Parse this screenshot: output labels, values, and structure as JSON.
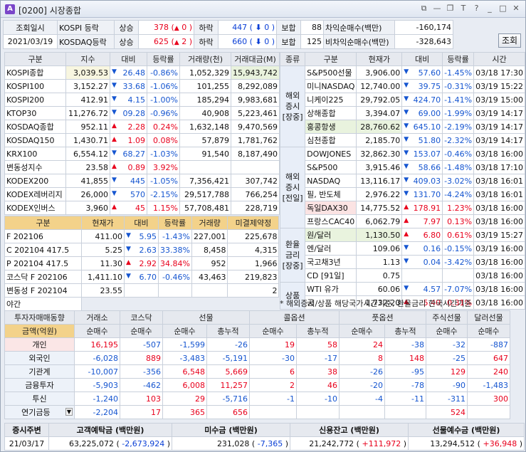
{
  "window": {
    "code": "[0200]",
    "title": "시장종합",
    "icon_letter": "A"
  },
  "header": {
    "date_label": "조회일시",
    "date": "2021/03/19",
    "kospi_label": "KOSPI 등락",
    "kosdaq_label": "KOSDAQ등락",
    "rise": "상승",
    "fall": "하락",
    "flat": "보합",
    "kospi": {
      "rise": "378",
      "rise_up": "0",
      "fall": "447",
      "fall_dn": "0",
      "flat": "88"
    },
    "kosdaq": {
      "rise": "625",
      "rise_up": "2",
      "fall": "660",
      "fall_dn": "0",
      "flat": "125"
    },
    "arb_label": "차익순매수",
    "nonarb_label": "비차익순매수",
    "unit": "(백만)",
    "arb": "-160,174",
    "nonarb": "-328,643",
    "refresh": "조회"
  },
  "indices": {
    "headers": [
      "구분",
      "지수",
      "대비",
      "등락률",
      "거래량(천)",
      "거래대금(M)"
    ],
    "rows": [
      {
        "name": "KOSPI종합",
        "value": "3,039.53",
        "dir": "dn",
        "chg": "26.48",
        "rate": "-0.86%",
        "vol": "1,052,329",
        "amt": "15,943,742"
      },
      {
        "name": "KOSPI100",
        "value": "3,152.27",
        "dir": "dn",
        "chg": "33.68",
        "rate": "-1.06%",
        "vol": "101,255",
        "amt": "8,292,089"
      },
      {
        "name": "KOSPI200",
        "value": "412.91",
        "dir": "dn",
        "chg": "4.15",
        "rate": "-1.00%",
        "vol": "185,294",
        "amt": "9,983,681"
      },
      {
        "name": "KTOP30",
        "value": "11,276.72",
        "dir": "dn",
        "chg": "09.28",
        "rate": "-0.96%",
        "vol": "40,908",
        "amt": "5,223,461"
      },
      {
        "name": "KOSDAQ종합",
        "value": "952.11",
        "dir": "up",
        "chg": "2.28",
        "rate": "0.24%",
        "vol": "1,632,148",
        "amt": "9,470,569"
      },
      {
        "name": "KOSDAQ150",
        "value": "1,430.71",
        "dir": "up",
        "chg": "1.09",
        "rate": "0.08%",
        "vol": "57,879",
        "amt": "1,781,762"
      },
      {
        "name": "KRX100",
        "value": "6,554.12",
        "dir": "dn",
        "chg": "68.27",
        "rate": "-1.03%",
        "vol": "91,540",
        "amt": "8,187,490"
      },
      {
        "name": "변동성지수",
        "value": "23.58",
        "dir": "up",
        "chg": "0.89",
        "rate": "3.92%",
        "vol": "",
        "amt": ""
      },
      {
        "name": "KODEX200",
        "value": "41,855",
        "dir": "dn",
        "chg": "445",
        "rate": "-1.05%",
        "vol": "7,356,421",
        "amt": "307,742"
      },
      {
        "name": "KODEX레버리지",
        "value": "26,000",
        "dir": "dn",
        "chg": "570",
        "rate": "-2.15%",
        "vol": "29,517,788",
        "amt": "766,254"
      },
      {
        "name": "KODEX인버스",
        "value": "3,960",
        "dir": "up",
        "chg": "45",
        "rate": "1.15%",
        "vol": "57,708,481",
        "amt": "228,719"
      }
    ]
  },
  "futures": {
    "headers": [
      "구분",
      "현재가",
      "대비",
      "등락률",
      "거래량",
      "미결제약정"
    ],
    "rows": [
      {
        "name": "F 202106",
        "value": "411.00",
        "dir": "dn",
        "chg": "5.95",
        "rate": "-1.43%",
        "vol": "227,001",
        "oi": "225,678"
      },
      {
        "name": "C 202104 417.5",
        "value": "5.25",
        "dir": "dn",
        "chg": "2.63",
        "rate": "33.38%",
        "vol": "8,458",
        "oi": "4,315"
      },
      {
        "name": "P 202104 417.5",
        "value": "11.30",
        "dir": "up",
        "chg": "2.92",
        "rate": "34.84%",
        "vol": "952",
        "oi": "1,966"
      },
      {
        "name": "코스닥 F 202106",
        "value": "1,411.10",
        "dir": "dn",
        "chg": "6.70",
        "rate": "-0.46%",
        "vol": "43,463",
        "oi": "219,823"
      },
      {
        "name": "변동성 F 202104",
        "value": "23.55",
        "dir": "",
        "chg": "",
        "rate": "",
        "vol": "",
        "oi": "2"
      }
    ],
    "night_label": "야간"
  },
  "world": {
    "headers": [
      "종류",
      "구분",
      "현재가",
      "대비",
      "등락률",
      "시간"
    ],
    "groups": [
      {
        "label": "해외증시[장중]",
        "rows": [
          {
            "name": "S&P500선물",
            "value": "3,906.00",
            "dir": "dn",
            "chg": "57.60",
            "rate": "-1.45%",
            "time": "03/18 17:30"
          },
          {
            "name": "미니NASDAQ",
            "value": "12,740.00",
            "dir": "dn",
            "chg": "39.75",
            "rate": "-0.31%",
            "time": "03/19 15:22"
          },
          {
            "name": "니케이225",
            "value": "29,792.05",
            "dir": "dn",
            "chg": "424.70",
            "rate": "-1.41%",
            "time": "03/19 15:00"
          },
          {
            "name": "상해종합",
            "value": "3,394.07",
            "dir": "dn",
            "chg": "69.00",
            "rate": "-1.99%",
            "time": "03/19 14:17"
          },
          {
            "name": "홍콩항생",
            "value": "28,760.62",
            "dir": "dn",
            "chg": "645.10",
            "rate": "-2.19%",
            "time": "03/19 14:17"
          },
          {
            "name": "심천종합",
            "value": "2,185.70",
            "dir": "dn",
            "chg": "51.80",
            "rate": "-2.32%",
            "time": "03/19 14:17"
          }
        ]
      },
      {
        "label": "해외증시[전일]",
        "rows": [
          {
            "name": "DOWJONES",
            "value": "32,862.30",
            "dir": "dn",
            "chg": "153.07",
            "rate": "-0.46%",
            "time": "03/18 16:00"
          },
          {
            "name": "S&P500",
            "value": "3,915.46",
            "dir": "dn",
            "chg": "58.66",
            "rate": "-1.48%",
            "time": "03/18 17:10"
          },
          {
            "name": "NASDAQ",
            "value": "13,116.17",
            "dir": "dn",
            "chg": "409.03",
            "rate": "-3.02%",
            "time": "03/18 16:01"
          },
          {
            "name": "필, 반도체",
            "value": "2,976.22",
            "dir": "dn",
            "chg": "131.70",
            "rate": "-4.24%",
            "time": "03/18 16:01"
          },
          {
            "name": "독일DAX30",
            "value": "14,775.52",
            "dir": "up",
            "chg": "178.91",
            "rate": "1.23%",
            "time": "03/18 16:00"
          },
          {
            "name": "프랑스CAC40",
            "value": "6,062.79",
            "dir": "up",
            "chg": "7.97",
            "rate": "0.13%",
            "time": "03/18 16:00"
          }
        ]
      },
      {
        "label": "환율금리[장중]",
        "rows": [
          {
            "name": "원/달러",
            "value": "1,130.50",
            "dir": "up",
            "chg": "6.80",
            "rate": "0.61%",
            "time": "03/19 15:27"
          },
          {
            "name": "엔/달러",
            "value": "109.06",
            "dir": "dn",
            "chg": "0.16",
            "rate": "-0.15%",
            "time": "03/19 16:00"
          },
          {
            "name": "국고채3년",
            "value": "1.13",
            "dir": "dn",
            "chg": "0.04",
            "rate": "-3.42%",
            "time": "03/18 16:00"
          },
          {
            "name": "CD [91일]",
            "value": "0.75",
            "dir": "",
            "chg": "",
            "rate": "",
            "time": "03/18 16:00"
          }
        ]
      },
      {
        "label": "상품",
        "rows": [
          {
            "name": "WTI 유가",
            "value": "60.06",
            "dir": "dn",
            "chg": "4.57",
            "rate": "-7.07%",
            "time": "03/18 16:00"
          },
          {
            "name": "금",
            "value": "1,732.20",
            "dir": "up",
            "chg": "5.40",
            "rate": "0.31%",
            "time": "03/18 16:00"
          }
        ]
      }
    ],
    "note": "* 해외증시/상품 해당국가시간기준, 환율금리 한국시간기준"
  },
  "investors": {
    "title": "투자자매매동향",
    "groups": [
      "거래소",
      "코스닥",
      "선물",
      "콜옵션",
      "풋옵션",
      "주식선물",
      "달러선물"
    ],
    "unit_label": "금액(억원)",
    "subheaders": [
      "순매수",
      "순매수",
      "순매수",
      "총누적",
      "순매수",
      "총누적",
      "순매수",
      "총누적",
      "순매수",
      "순매수"
    ],
    "rows": [
      {
        "name": "개인",
        "vals": [
          "16,195",
          "-507",
          "-1,599",
          "-26",
          "19",
          "58",
          "24",
          "-38",
          "-32",
          "-887"
        ]
      },
      {
        "name": "외국인",
        "vals": [
          "-6,028",
          "889",
          "-3,483",
          "-5,191",
          "-30",
          "-17",
          "8",
          "148",
          "-25",
          "647"
        ]
      },
      {
        "name": "기관계",
        "vals": [
          "-10,007",
          "-356",
          "6,548",
          "5,669",
          "6",
          "38",
          "-26",
          "-95",
          "129",
          "240"
        ]
      },
      {
        "name": "금융투자",
        "vals": [
          "-5,903",
          "-462",
          "6,008",
          "11,257",
          "2",
          "46",
          "-20",
          "-78",
          "-90",
          "-1,483"
        ]
      },
      {
        "name": "투신",
        "vals": [
          "-1,240",
          "103",
          "29",
          "-5,716",
          "-1",
          "-10",
          "-4",
          "-11",
          "-311",
          "300"
        ]
      },
      {
        "name": "연기금등",
        "vals": [
          "-2,204",
          "17",
          "365",
          "656",
          "",
          "",
          "",
          "",
          "524",
          ""
        ]
      }
    ]
  },
  "bottom": {
    "headers": [
      "증시주변",
      "고객예탁금 (백만원)",
      "미수금 (백만원)",
      "신용잔고 (백만원)",
      "선물예수금 (백만원)"
    ],
    "date": "21/03/17",
    "deposit": "63,225,072",
    "deposit_chg": "-2,673,924",
    "unpaid": "231,028",
    "unpaid_chg": "-7,365",
    "credit": "21,242,772",
    "credit_chg": "+111,972",
    "fut": "13,294,512",
    "fut_chg": "+36,948"
  }
}
